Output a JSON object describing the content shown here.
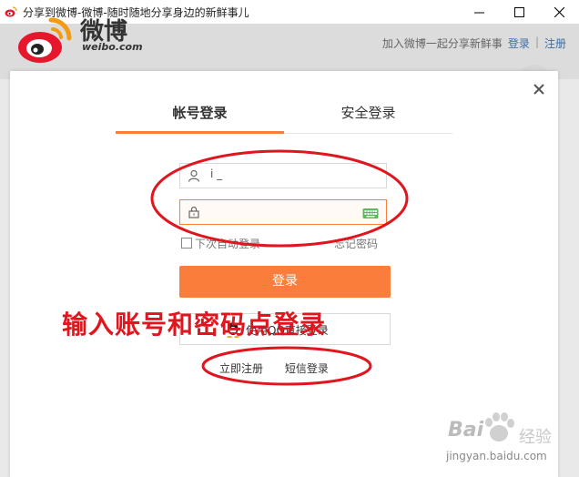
{
  "window": {
    "title": "分享到微博-微博-随时随地分享身边的新鲜事儿",
    "controls": [
      "minimize-icon",
      "maximize-icon",
      "close-icon"
    ]
  },
  "header": {
    "logo_text": "微博",
    "logo_sub": "weibo.com",
    "join_text": "加入微博一起分享新鲜事",
    "login_link": "登录",
    "separator": "|",
    "register_link": "注册"
  },
  "login_dialog": {
    "tabs": [
      {
        "label": "帐号登录",
        "active": true
      },
      {
        "label": "安全登录",
        "active": false
      }
    ],
    "username_value": "i          _",
    "password_value": "",
    "remember_label": "下次自动登录",
    "forgot_label": "忘记密码",
    "login_button": "登录",
    "qq_button": "使用QQ直接登录",
    "register_link": "立即注册",
    "sms_login_link": "短信登录",
    "accent_color": "#fa7d3c"
  },
  "annotation": {
    "text": "输入账号和密码点登录",
    "color": "#e0151e"
  },
  "watermark": {
    "brand": "Bai",
    "suffix": "经验",
    "url": "jingyan.baidu.com"
  }
}
